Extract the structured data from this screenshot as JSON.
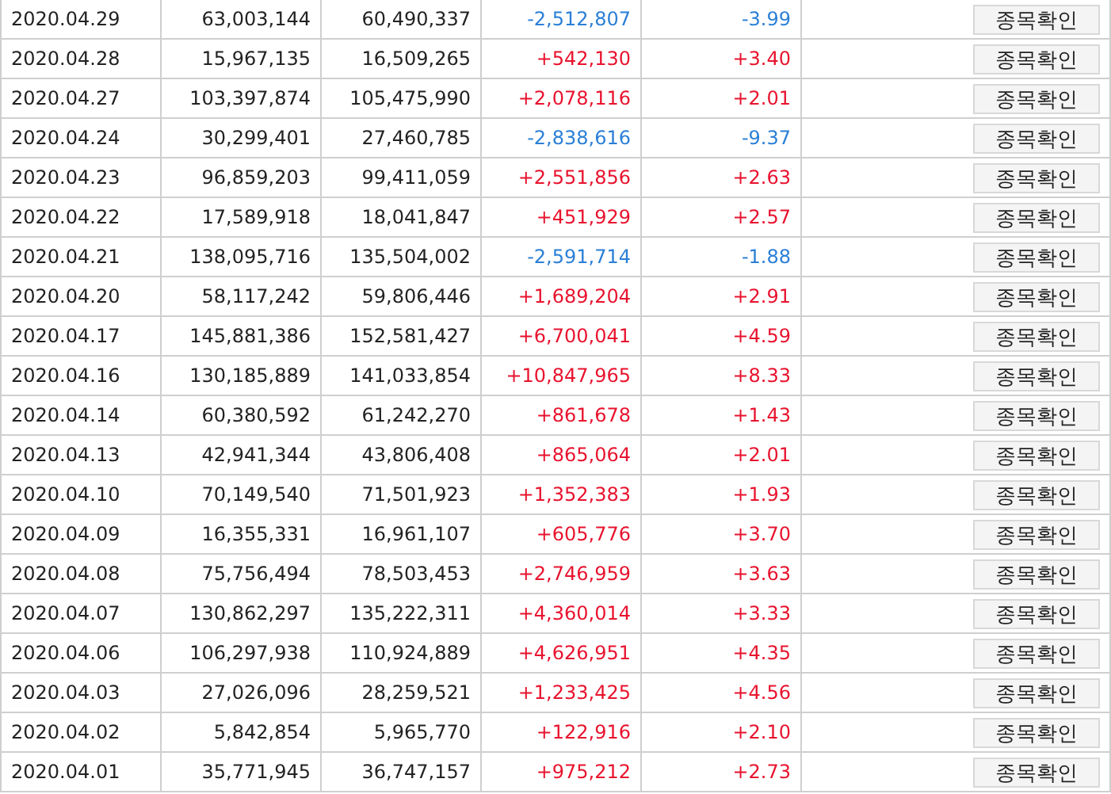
{
  "table": {
    "rows": [
      {
        "date": "2020.04.29",
        "column_2": "63,003,144",
        "column_3": "60,490,337",
        "change": "-2,512,807",
        "rate": "-3.99",
        "color": "#2a7fd6",
        "button": "종목확인"
      },
      {
        "date": "2020.04.28",
        "column_2": "15,967,135",
        "column_3": "16,509,265",
        "change": "+542,130",
        "rate": "+3.40",
        "color": "#e8132e",
        "button": "종목확인"
      },
      {
        "date": "2020.04.27",
        "column_2": "103,397,874",
        "column_3": "105,475,990",
        "change": "+2,078,116",
        "rate": "+2.01",
        "color": "#e8132e",
        "button": "종목확인"
      },
      {
        "date": "2020.04.24",
        "column_2": "30,299,401",
        "column_3": "27,460,785",
        "change": "-2,838,616",
        "rate": "-9.37",
        "color": "#2a7fd6",
        "button": "종목확인"
      },
      {
        "date": "2020.04.23",
        "column_2": "96,859,203",
        "column_3": "99,411,059",
        "change": "+2,551,856",
        "rate": "+2.63",
        "color": "#e8132e",
        "button": "종목확인"
      },
      {
        "date": "2020.04.22",
        "column_2": "17,589,918",
        "column_3": "18,041,847",
        "change": "+451,929",
        "rate": "+2.57",
        "color": "#e8132e",
        "button": "종목확인"
      },
      {
        "date": "2020.04.21",
        "column_2": "138,095,716",
        "column_3": "135,504,002",
        "change": "-2,591,714",
        "rate": "-1.88",
        "color": "#2a7fd6",
        "button": "종목확인"
      },
      {
        "date": "2020.04.20",
        "column_2": "58,117,242",
        "column_3": "59,806,446",
        "change": "+1,689,204",
        "rate": "+2.91",
        "color": "#e8132e",
        "button": "종목확인"
      },
      {
        "date": "2020.04.17",
        "column_2": "145,881,386",
        "column_3": "152,581,427",
        "change": "+6,700,041",
        "rate": "+4.59",
        "color": "#e8132e",
        "button": "종목확인"
      },
      {
        "date": "2020.04.16",
        "column_2": "130,185,889",
        "column_3": "141,033,854",
        "change": "+10,847,965",
        "rate": "+8.33",
        "color": "#e8132e",
        "button": "종목확인"
      },
      {
        "date": "2020.04.14",
        "column_2": "60,380,592",
        "column_3": "61,242,270",
        "change": "+861,678",
        "rate": "+1.43",
        "color": "#e8132e",
        "button": "종목확인"
      },
      {
        "date": "2020.04.13",
        "column_2": "42,941,344",
        "column_3": "43,806,408",
        "change": "+865,064",
        "rate": "+2.01",
        "color": "#e8132e",
        "button": "종목확인"
      },
      {
        "date": "2020.04.10",
        "column_2": "70,149,540",
        "column_3": "71,501,923",
        "change": "+1,352,383",
        "rate": "+1.93",
        "color": "#e8132e",
        "button": "종목확인"
      },
      {
        "date": "2020.04.09",
        "column_2": "16,355,331",
        "column_3": "16,961,107",
        "change": "+605,776",
        "rate": "+3.70",
        "color": "#e8132e",
        "button": "종목확인"
      },
      {
        "date": "2020.04.08",
        "column_2": "75,756,494",
        "column_3": "78,503,453",
        "change": "+2,746,959",
        "rate": "+3.63",
        "color": "#e8132e",
        "button": "종목확인"
      },
      {
        "date": "2020.04.07",
        "column_2": "130,862,297",
        "column_3": "135,222,311",
        "change": "+4,360,014",
        "rate": "+3.33",
        "color": "#e8132e",
        "button": "종목확인"
      },
      {
        "date": "2020.04.06",
        "column_2": "106,297,938",
        "column_3": "110,924,889",
        "change": "+4,626,951",
        "rate": "+4.35",
        "color": "#e8132e",
        "button": "종목확인"
      },
      {
        "date": "2020.04.03",
        "column_2": "27,026,096",
        "column_3": "28,259,521",
        "change": "+1,233,425",
        "rate": "+4.56",
        "color": "#e8132e",
        "button": "종목확인"
      },
      {
        "date": "2020.04.02",
        "column_2": "5,842,854",
        "column_3": "5,965,770",
        "change": "+122,916",
        "rate": "+2.10",
        "color": "#e8132e",
        "button": "종목확인"
      },
      {
        "date": "2020.04.01",
        "column_2": "35,771,945",
        "column_3": "36,747,157",
        "change": "+975,212",
        "rate": "+2.73",
        "color": "#e8132e",
        "button": "종목확인"
      }
    ]
  }
}
